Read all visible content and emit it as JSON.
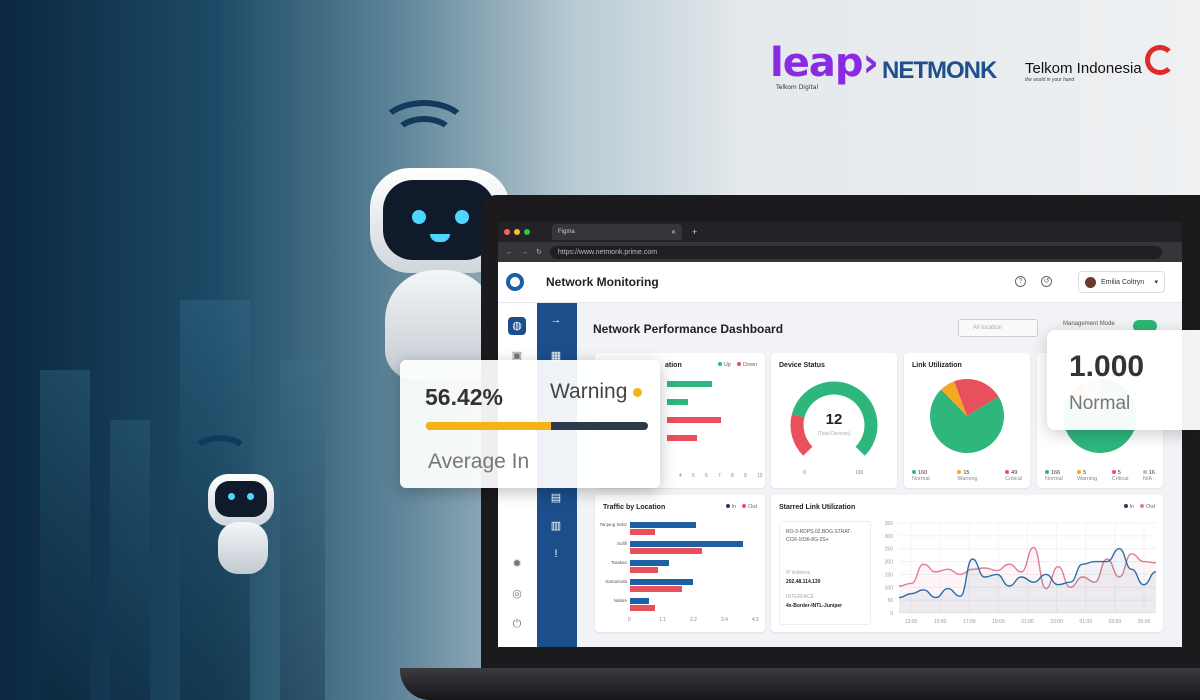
{
  "logos": {
    "leap": "leap",
    "leap_sub": "Telkom Digital",
    "netmonk": "NETMONK",
    "telkom": "Telkom Indonesia",
    "telkom_tagline": "the world in your hand"
  },
  "browser": {
    "tab_title": "Figma",
    "url": "https://www.netmonk.prime.com"
  },
  "header": {
    "title": "Network Monitoring",
    "user_name": "Emilia Coltryn"
  },
  "dashboard": {
    "title": "Network Performance Dashboard",
    "location_placeholder": "All location",
    "mode_label": "Management Mode",
    "mode_on": true
  },
  "availability_card": {
    "title_fragment": "ation",
    "legend": [
      "Up",
      "Down"
    ],
    "x_ticks": [
      "4",
      "5",
      "6",
      "7",
      "8",
      "9",
      "10"
    ],
    "bars": [
      {
        "status": "Up",
        "value": 6.5
      },
      {
        "status": "Up",
        "value": 4.6
      },
      {
        "status": "Down",
        "value": 7.2
      },
      {
        "status": "Down",
        "value": 5.3
      }
    ]
  },
  "device_status": {
    "title": "Device Status",
    "value": "12",
    "subtitle": "(Total Devices)",
    "min": "0",
    "max": "100",
    "down_fraction": 0.22
  },
  "link_utilization": {
    "title": "Link Utilization",
    "slices": [
      {
        "value": 160,
        "label": "Normal",
        "color": "#2eb67d"
      },
      {
        "value": 15,
        "label": "Warning",
        "color": "#f5a623"
      },
      {
        "value": 49,
        "label": "Critical",
        "color": "#e8505b"
      }
    ]
  },
  "status_pie": {
    "slices": [
      {
        "value": 166,
        "label": "Normal",
        "color": "#2eb67d"
      },
      {
        "value": 5,
        "label": "Warning",
        "color": "#f5a623"
      },
      {
        "value": 5,
        "label": "Critical",
        "color": "#e8505b"
      },
      {
        "value": 16,
        "label": "N/A",
        "color": "#b7bcc4"
      }
    ]
  },
  "traffic": {
    "title": "Traffic by Location",
    "legend": [
      "In",
      "Out"
    ],
    "x_ticks": [
      "0",
      "1.1",
      "2.2",
      "3.4",
      "4.5"
    ],
    "max": 4.5,
    "rows": [
      {
        "label": "Tanjung Selor",
        "in": 2.4,
        "out": 0.9
      },
      {
        "label": "Sofifi",
        "in": 4.1,
        "out": 2.6
      },
      {
        "label": "Tarakan",
        "in": 1.4,
        "out": 1.0
      },
      {
        "label": "Samarinda",
        "in": 2.3,
        "out": 1.9
      },
      {
        "label": "Nabire",
        "in": 0.7,
        "out": 0.9
      }
    ]
  },
  "starred": {
    "title": "Starred Link Utilization",
    "legend": [
      "In",
      "Out"
    ],
    "device": "RO-3-RDPS.02.BOG.STRAT-CCR-1036-8G-2S+",
    "ip_label": "IP Address",
    "ip": "202.48.114.130",
    "iface_label": "INTERFACE",
    "iface": "4x-Border-INTL-Juniper"
  },
  "chart_data": {
    "type": "line",
    "ylim": [
      0,
      350
    ],
    "y_ticks": [
      "0",
      "50",
      "100",
      "150",
      "200",
      "250",
      "300",
      "350"
    ],
    "x_ticks": [
      "13:00",
      "15:00",
      "17:00",
      "19:00",
      "21:00",
      "23:00",
      "01:00",
      "03:00",
      "05:00"
    ],
    "series": [
      {
        "name": "In",
        "color": "#2f6ea5",
        "values": [
          60,
          75,
          90,
          60,
          95,
          65,
          210,
          140,
          150,
          105,
          140,
          120,
          150,
          110,
          120,
          190,
          200,
          200,
          250,
          170,
          110,
          160
        ]
      },
      {
        "name": "Out",
        "color": "#e07b93",
        "values": [
          105,
          115,
          190,
          160,
          170,
          150,
          170,
          175,
          165,
          190,
          160,
          255,
          95,
          180,
          100,
          140,
          120,
          210,
          140,
          230,
          200,
          195
        ]
      }
    ]
  },
  "overlay_average": {
    "value": "56.42%",
    "status": "Warning",
    "label": "Average In",
    "progress": 0.5642,
    "status_color": "#f5b316"
  },
  "overlay_normal": {
    "value": "1.000",
    "label": "Normal"
  }
}
